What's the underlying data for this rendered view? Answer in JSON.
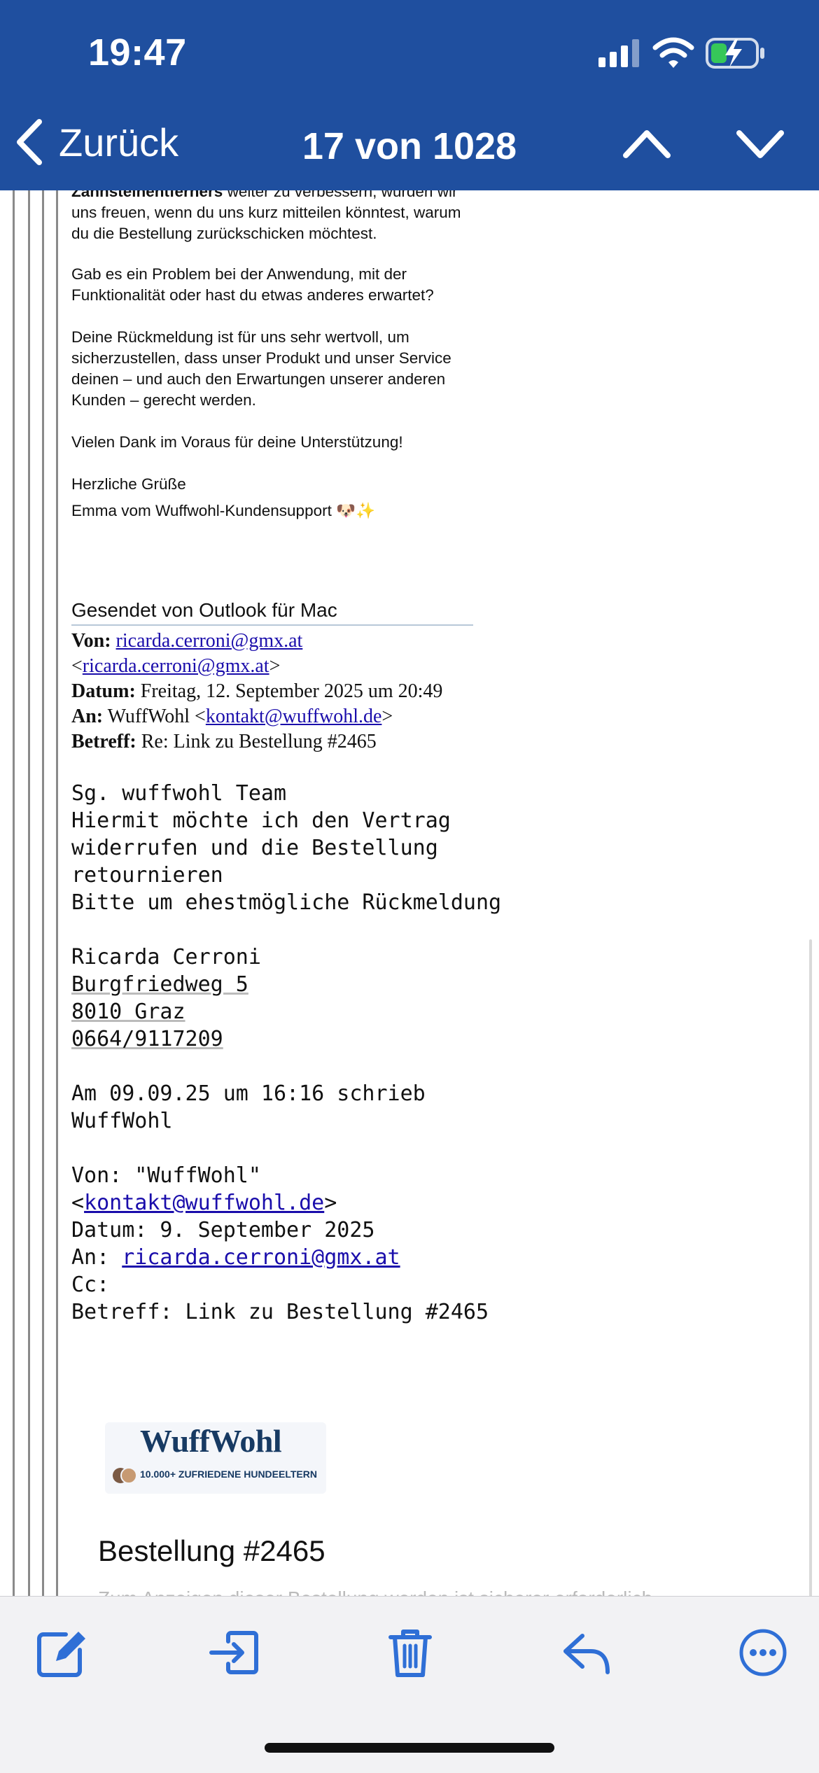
{
  "status_bar": {
    "time": "19:47",
    "signal_icon": "cellular-signal-icon",
    "wifi_icon": "wifi-icon",
    "battery_icon": "battery-charging-icon"
  },
  "nav": {
    "back_label": "Zurück",
    "counter": "17 von 1028"
  },
  "colors": {
    "header_bg": "#1f4f9f",
    "accent": "#2f6fd6",
    "link": "#1a0dab"
  },
  "reply_message": {
    "partial_line_bold": "Zahnsteinentferners",
    "partial_line_rest": " weiter zu verbessern, würden wir",
    "intro_rest": "uns freuen, wenn du uns kurz mitteilen könntest, warum du die Bestellung zurückschicken möchtest.",
    "question": "Gab es ein Problem bei der Anwendung, mit der Funktionalität oder hast du etwas anderes erwartet?",
    "feedback": "Deine Rückmeldung ist für uns sehr wertvoll, um sicherzustellen, dass unser Produkt und unser Service deinen – und auch den Erwartungen unserer anderen Kunden – gerecht werden.",
    "thanks": "Vielen Dank im Voraus für deine Unterstützung!",
    "greeting": "Herzliche Grüße",
    "signature": "Emma vom Wuffwohl-Kundensupport 🐶✨",
    "sent_from": "Gesendet von Outlook für Mac"
  },
  "quoted_header": {
    "from_label": "Von:",
    "from_email": "ricarda.cerroni@gmx.at",
    "date_label": "Datum:",
    "date_value": "Freitag, 12. September 2025 um 20:49",
    "to_label": "An:",
    "to_name": "WuffWohl",
    "to_email": "kontakt@wuffwohl.de",
    "subject_label": "Betreff:",
    "subject_value": "Re: Link zu Bestellung #2465"
  },
  "customer_message": {
    "greeting": "Sg. wuffwohl Team",
    "line1": "Hiermit möchte ich den Vertrag",
    "line2": "widerrufen und die Bestellung",
    "line3": "retournieren",
    "line4": "Bitte um ehestmögliche Rückmeldung",
    "name": "Ricarda Cerroni",
    "street": "Burgfriedweg 5",
    "city": "8010 Graz",
    "phone": "0664/9117209",
    "wrote_line1": "Am 09.09.25 um 16:16 schrieb",
    "wrote_line2": "WuffWohl"
  },
  "original_header": {
    "from_line": "Von: \"WuffWohl\"",
    "from_email": "kontakt@wuffwohl.de",
    "date_line": "Datum: 9. September 2025",
    "to_label": "An:",
    "to_email": "ricarda.cerroni@gmx.at",
    "cc_line": "Cc:",
    "subject_line": "Betreff: Link zu Bestellung #2465"
  },
  "shop": {
    "logo_text": "WuffWohl",
    "tagline": "10.000+ ZUFRIEDENE HUNDEELTERN",
    "order_title": "Bestellung #2465",
    "order_subtitle_partial": "Zum Anzeigen dieser Bestellung werden ist sicherer erforderlich"
  },
  "toolbar": {
    "compose_icon": "compose-icon",
    "move_icon": "move-to-folder-icon",
    "trash_icon": "trash-icon",
    "reply_icon": "reply-icon",
    "more_icon": "more-icon"
  }
}
